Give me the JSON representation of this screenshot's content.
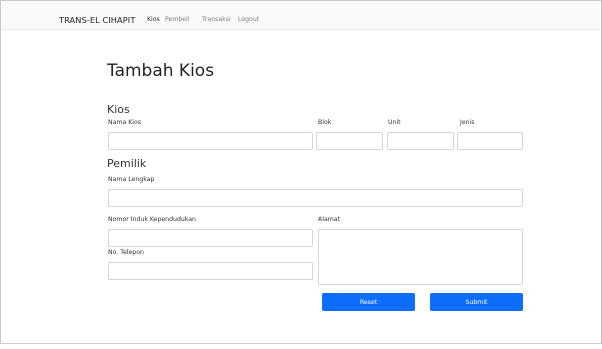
{
  "navbar": {
    "brand": "TRANS-EL CIHAPIT",
    "links": [
      "Kios",
      "Pembeli",
      "Transaksi",
      "Logout"
    ]
  },
  "page": {
    "title": "Tambah Kios"
  },
  "kios": {
    "heading": "Kios",
    "labels": {
      "nama": "Nama Kios",
      "blok": "Blok",
      "unit": "Unit",
      "jenis": "Jenis"
    },
    "values": {
      "nama": "",
      "blok": "",
      "unit": "",
      "jenis": ""
    }
  },
  "pemilik": {
    "heading": "Pemilik",
    "labels": {
      "nama_lengkap": "Nama Lengkap",
      "nik": "Nomor Induk Kependudukan",
      "alamat": "Alamat",
      "telepon": "No. Telepon"
    },
    "values": {
      "nama_lengkap": "",
      "nik": "",
      "alamat": "",
      "telepon": ""
    }
  },
  "buttons": {
    "reset": "Reset",
    "submit": "Submit"
  },
  "colors": {
    "primary": "#0d6efd",
    "navbar_bg": "#f8f9fa"
  }
}
